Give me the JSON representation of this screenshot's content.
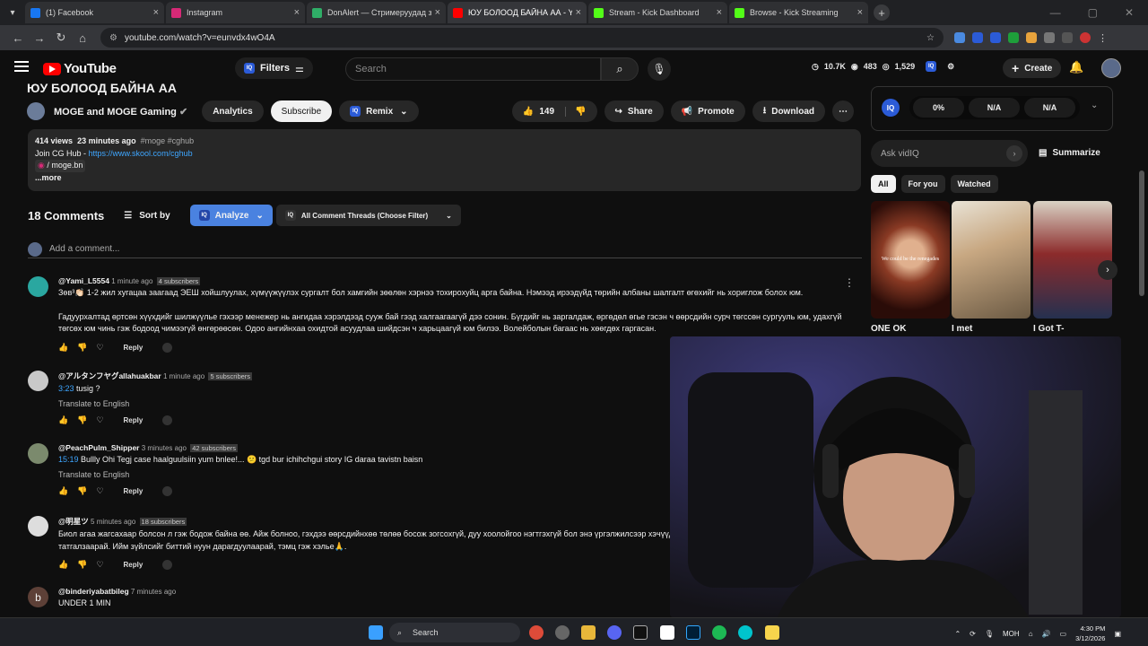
{
  "browser": {
    "tabs": [
      {
        "title": "(1) Facebook",
        "color": "#1877f2",
        "active": false
      },
      {
        "title": "Instagram",
        "color": "#d62976",
        "active": false
      },
      {
        "title": "DonAlert — Стримеруудад зор",
        "color": "#2fae67",
        "active": false
      },
      {
        "title": "ЮУ БОЛООД БАЙНА АА - You",
        "color": "#ff0000",
        "active": true
      },
      {
        "title": "Stream - Kick Dashboard",
        "color": "#53fc18",
        "active": false
      },
      {
        "title": "Browse - Kick Streaming",
        "color": "#53fc18",
        "active": false
      }
    ],
    "url": "youtube.com/watch?v=eunvdx4wO4A"
  },
  "masthead": {
    "logo": "YouTube",
    "filters": "Filters",
    "search_placeholder": "Search",
    "stats": [
      "10.7K",
      "483",
      "1,529"
    ],
    "create": "Create"
  },
  "video": {
    "title": "ЮУ БОЛООД БАЙНА АА",
    "channel": "MOGE and MOGE Gaming",
    "analytics": "Analytics",
    "subscribe": "Subscribe",
    "remix": "Remix",
    "likes": "149",
    "share": "Share",
    "promote": "Promote",
    "download": "Download",
    "description": {
      "views": "414 views",
      "time": "23 minutes ago",
      "tags": "#moge #cghub",
      "join": "Join CG Hub - ",
      "link": "https://www.skool.com/cghub",
      "insta": "/ moge.bn",
      "more": "...more"
    }
  },
  "comments_header": {
    "count": "18 Comments",
    "sort": "Sort by",
    "analyze": "Analyze",
    "threads": "All Comment Threads (Choose Filter)",
    "add_placeholder": "Add a comment..."
  },
  "comments": [
    {
      "user": "@Yami_L5554",
      "time": "1 minute ago",
      "subs": "4 subscribers",
      "avatar_color": "#2aa7a0",
      "text": "Зөв³👏🏻 1-2 жил хугацаа заагаад ЭЕШ хойшлуулах, хүмүүжүүлэх сургалт бол хамгийн зөөлөн хэрнээ тохирохуйц арга байна. Нэмээд ирээдүйд төрийн албаны шалгалт өгөхийг нь хориглож болох юм.",
      "text2": "Гадуурхалтад өртсөн хүүхдийг шилжүүлье гэхээр менежер нь ангидаа хэрэлдээд сууж бай гээд халгаагаагүй дээ сонин. Бүгдийг нь заргалдаж, өргөдөл өгье гэсэн ч өөрсдийн сурч төгссөн сургууль юм, удахгүй төгсөх юм чинь гэж бодоод чимээгүй өнгөрөөсөн. Одоо   ангийнхаа охидтой асуудлаа шийдсэн ч харьцаагүй юм билээ. Волейболын багаас нь хөөгдөх гаргасан.",
      "reply": "Reply"
    },
    {
      "user": "@アルタンフヤグallahuakbar",
      "time": "1 minute ago",
      "subs": "5 subscribers",
      "avatar_color": "#c9c9c9",
      "timestamp": "3:23",
      "text": " tusig ?",
      "translate": "Translate to English",
      "reply": "Reply"
    },
    {
      "user": "@PeachPulm_Shipper",
      "time": "3 minutes ago",
      "subs": "42 subscribers",
      "avatar_color": "#7b8a6d",
      "timestamp": "15:19",
      "text": " Bullly Ohi Tegj case haalguulsiin yum bnlee!... 😕 tgd  bur ichihchgui story IG daraa tavistn baisn",
      "translate": "Translate to English",
      "reply": "Reply"
    },
    {
      "user": "@明星ツ",
      "time": "5 minutes ago",
      "subs": "18 subscribers",
      "avatar_color": "#ddd",
      "text": "Биол агаа жагсахаар болсон л гэж бодож байна өө. Айж болноо, гэхдээ өөрсдийнхөө төлөө босож зогсохгүй, дуу хоолойгоо нэгтгэхгүй бол энэ үргэлжилсээр хэчүүдээ. Бүгдэг нь уриалан дуудая, жагсая гэвэл бүү татгалзаарай. Ийм зүйлсийг биттий нуун дарагдуулаарай, тэмц гэж хэлье🙏.",
      "reply": "Reply"
    },
    {
      "user": "@binderiyabatbileg",
      "time": "7 minutes ago",
      "avatar_letter": "b",
      "avatar_color": "#5d4037",
      "text": "UNDER 1 MIN"
    }
  ],
  "vidiq": {
    "metrics": [
      "0%",
      "N/A",
      "N/A"
    ],
    "ask": "Ask vidIQ",
    "summarize": "Summarize"
  },
  "related": {
    "chips": [
      "All",
      "For you",
      "Watched"
    ],
    "videos": [
      {
        "title": "ONE OK",
        "overlay": "We could be the renegades",
        "color": "#7a2a1e"
      },
      {
        "title": "I met",
        "color": "#c8a882"
      },
      {
        "title": "I Got T-",
        "color": "#3a3f55"
      }
    ]
  },
  "taskbar": {
    "search": "Search",
    "lang": "МОН",
    "time": "4:30 PM",
    "date": "3/12/2026"
  }
}
